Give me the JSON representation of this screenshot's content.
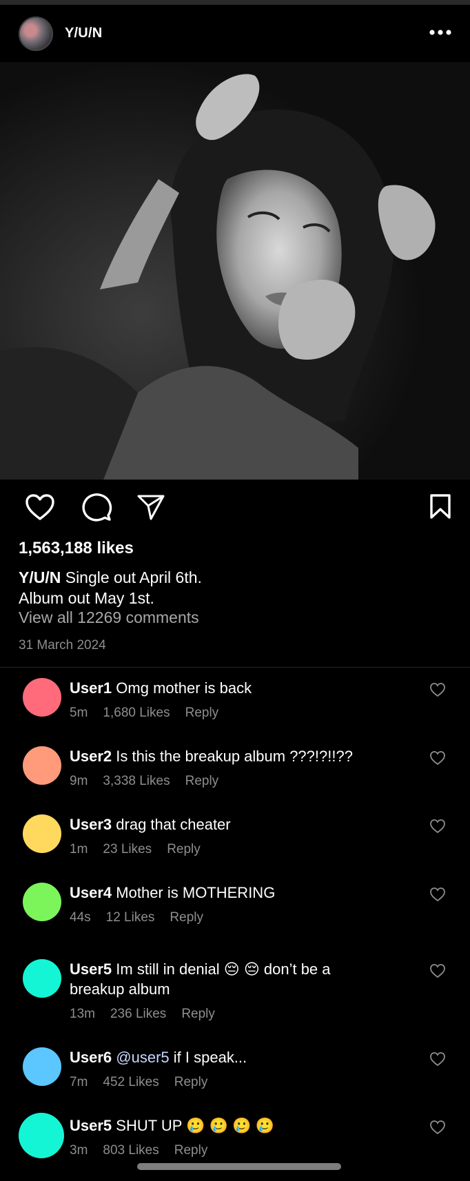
{
  "header": {
    "username": "Y/U/N"
  },
  "post": {
    "likes": "1,563,188 likes",
    "caption_user": "Y/U/N",
    "caption_line1": "Single out April 6th.",
    "caption_line2": "Album out May 1st.",
    "view_all": "View all 12269 comments",
    "date": "31 March 2024"
  },
  "icons": {
    "more": "more-icon",
    "like": "heart-icon",
    "comment": "comment-icon",
    "share": "send-icon",
    "save": "bookmark-icon"
  },
  "comments": [
    {
      "user": "User1",
      "text": "Omg mother is back",
      "time": "5m",
      "likes": "1,680 Likes",
      "reply": "Reply",
      "color": "#ff6b7a"
    },
    {
      "user": "User2",
      "text": "Is this the breakup album ???!?!!??",
      "time": "9m",
      "likes": "3,338 Likes",
      "reply": "Reply",
      "color": "#ff9a7a"
    },
    {
      "user": "User3",
      "text": "drag that cheater",
      "time": "1m",
      "likes": "23 Likes",
      "reply": "Reply",
      "color": "#ffd95e"
    },
    {
      "user": "User4",
      "text": "Mother is MOTHERING",
      "time": "44s",
      "likes": "12 Likes",
      "reply": "Reply",
      "color": "#7cf55a"
    },
    {
      "user": "User5",
      "text": "Im still in denial 😔 😔  don’t be a breakup album",
      "time": "13m",
      "likes": "236 Likes",
      "reply": "Reply",
      "color": "#14f5d5"
    },
    {
      "user": "User6",
      "mention": "@user5",
      "text": "if I speak...",
      "time": "7m",
      "likes": "452 Likes",
      "reply": "Reply",
      "color": "#5cc6ff"
    },
    {
      "user": "User5",
      "text": "SHUT UP 🥲 🥲 🥲 🥲",
      "time": "3m",
      "likes": "803 Likes",
      "reply": "Reply",
      "color": "#14f5d5"
    }
  ]
}
